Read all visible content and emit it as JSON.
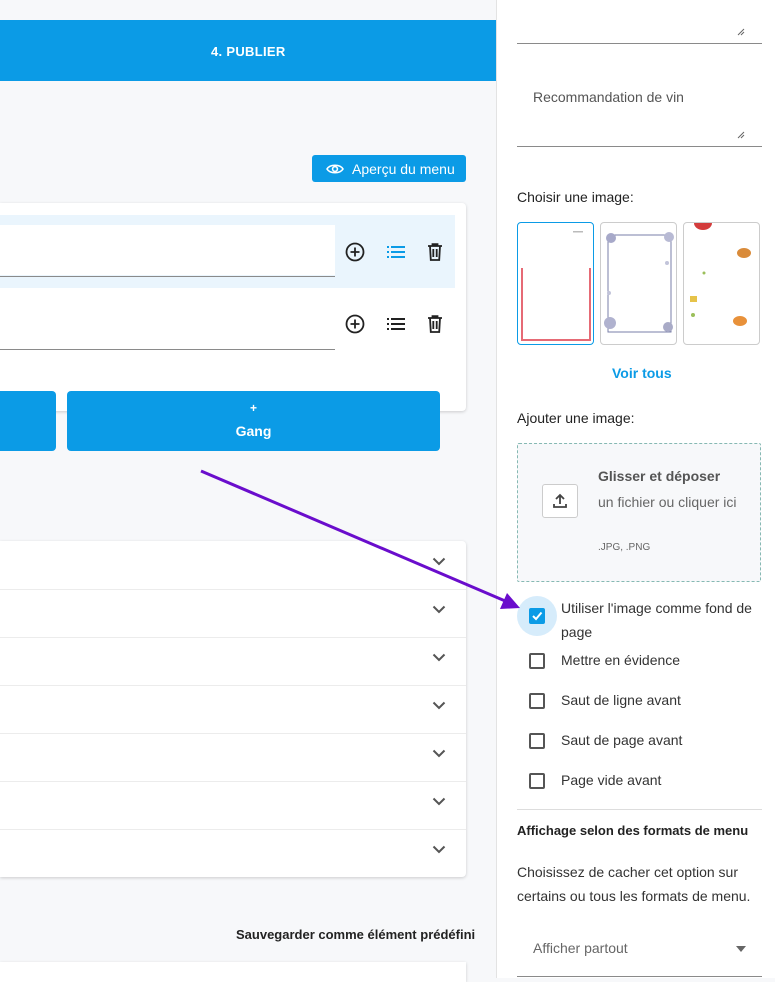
{
  "stepbar": {
    "step_label": "4. PUBLIER"
  },
  "toolbar": {
    "preview_label": "Aperçu du menu"
  },
  "buttons": {
    "gang_plus": "+",
    "gang_label": "Gang"
  },
  "footer": {
    "save_preset": "Sauvegarder comme élément prédéfini"
  },
  "panel": {
    "wine_label": "Recommandation de vin",
    "choose_image_label": "Choisir une image:",
    "see_all": "Voir tous",
    "add_image_label": "Ajouter une image:",
    "dropzone": {
      "title": "Glisser et déposer",
      "subtitle": "un fichier ou cliquer ici",
      "formats": ".JPG, .PNG"
    },
    "checkboxes": [
      {
        "label": "Utiliser l'image comme fond de page",
        "checked": true
      },
      {
        "label": "Mettre en évidence",
        "checked": false
      },
      {
        "label": "Saut de ligne avant",
        "checked": false
      },
      {
        "label": "Saut de page avant",
        "checked": false
      },
      {
        "label": "Page vide avant",
        "checked": false
      }
    ],
    "display_section": {
      "title": "Affichage selon des formats de menu",
      "description": "Choisissez de cacher cet option sur certains ou tous les formats de menu.",
      "select_value": "Afficher partout"
    }
  },
  "colors": {
    "accent": "#0b9be6",
    "annotation_arrow": "#6a0dcc"
  },
  "icons": [
    "eye-icon",
    "add-circle-icon",
    "list-icon",
    "trash-icon",
    "chevron-down-icon",
    "upload-icon",
    "check-icon",
    "caret-down-icon"
  ]
}
